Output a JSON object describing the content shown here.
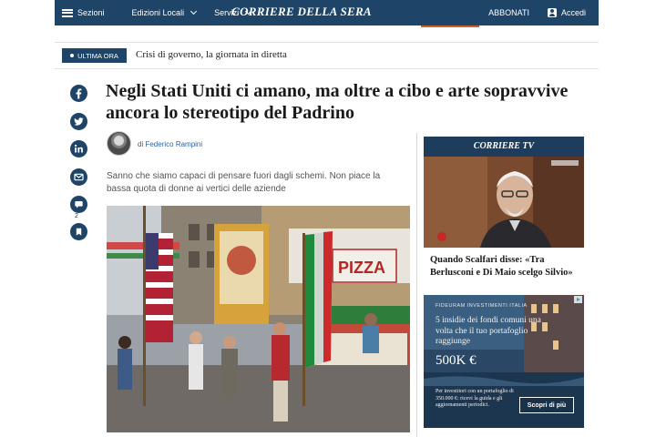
{
  "header": {
    "sections_label": "Sezioni",
    "editions_label": "Edizioni Locali",
    "services_label": "Servizi",
    "masthead": "CORRIERE DELLA SERA",
    "subscribe_label": "ABBONATI",
    "login_label": "Accedi"
  },
  "breaking": {
    "badge_label": "ULTIMA ORA",
    "text": "Crisi di governo, la giornata in diretta"
  },
  "share": {
    "comment_count": "2"
  },
  "article": {
    "headline": "Negli Stati Uniti ci amano, ma oltre a cibo e arte sopravvive ancora lo stereotipo del Padrino",
    "byline_prefix": "di",
    "author": "Federico Rampini",
    "subtitle": "Sanno che siamo capaci di pensare fuori dagli schemi. Non piace la bassa quota di donne ai vertici delle aziende",
    "photo_sign": "PIZZA"
  },
  "sidebar": {
    "tv_label": "CORRIERE TV",
    "tv_caption": "Quando Scalfari disse: «Tra Berlusconi e Di Maio scelgo Silvio»"
  },
  "ad": {
    "brand": "FIDEURAM INVESTIMENTI ITALIA",
    "headline": "5 insidie dei fondi comuni una volta che il tuo portafoglio raggiunge",
    "amount": "500K €",
    "footnote": "Per investitori con un portafoglio di 350.000 €: ricevi la guida e gli aggiornamenti periodici.",
    "cta": "Scopri di più"
  },
  "colors": {
    "navy": "#1e4468",
    "link_blue": "#2a63a6"
  }
}
